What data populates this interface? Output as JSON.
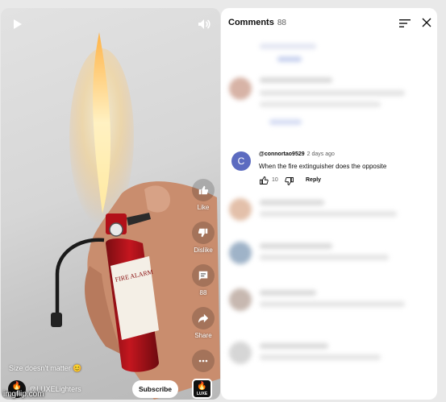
{
  "video": {
    "caption": "Size doesn't matter 😊",
    "channel_handle": "@LUXELighters",
    "channel_logo_text": "LUXE",
    "subscribe_label": "Subscribe",
    "sound_logo_text": "LUXE",
    "extinguisher_label": "FIRE ALARM",
    "controls": {
      "play_icon": "play-icon",
      "volume_icon": "volume-icon"
    },
    "actions": [
      {
        "icon": "thumbs-up-icon",
        "label": "Like"
      },
      {
        "icon": "thumbs-down-icon",
        "label": "Dislike"
      },
      {
        "icon": "comment-icon",
        "label": "88"
      },
      {
        "icon": "share-icon",
        "label": "Share"
      },
      {
        "icon": "more-icon",
        "label": ""
      }
    ]
  },
  "comments": {
    "title": "Comments",
    "count": "88",
    "sort_icon": "sort-icon",
    "close_icon": "close-icon",
    "featured": {
      "avatar_letter": "C",
      "avatar_color": "#5c6bc0",
      "user": "@connortao9529",
      "time": "2 days ago",
      "text": "When the fire extinguisher does the opposite",
      "likes": "10",
      "reply_label": "Reply"
    }
  },
  "watermark": "imgflip.com"
}
